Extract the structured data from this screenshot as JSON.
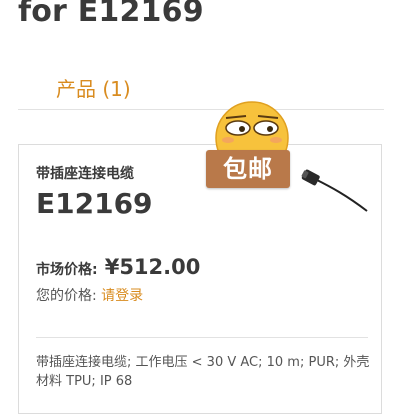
{
  "page": {
    "title": "for E12169",
    "tab_label": "产品 (1)"
  },
  "product": {
    "name": "带插座连接电缆",
    "code": "E12169",
    "market_price_label": "市场价格:",
    "market_price_value": "¥512.00",
    "your_price_label": "您的价格:",
    "login_link": "请登录",
    "description": "带插座连接电缆; 工作电压 < 30 V AC; 10 m; PUR; 外壳材料 TPU; IP 68",
    "image_icon": "cable-connector-icon"
  },
  "sticker": {
    "label": "包邮",
    "icon": "emoji-face-icon"
  },
  "colors": {
    "accent": "#d98c20",
    "text_dark": "#3a3a3a",
    "border": "#dcdcdc",
    "sticker_bg": "#b9794a",
    "emoji_face": "#f7c23c"
  }
}
